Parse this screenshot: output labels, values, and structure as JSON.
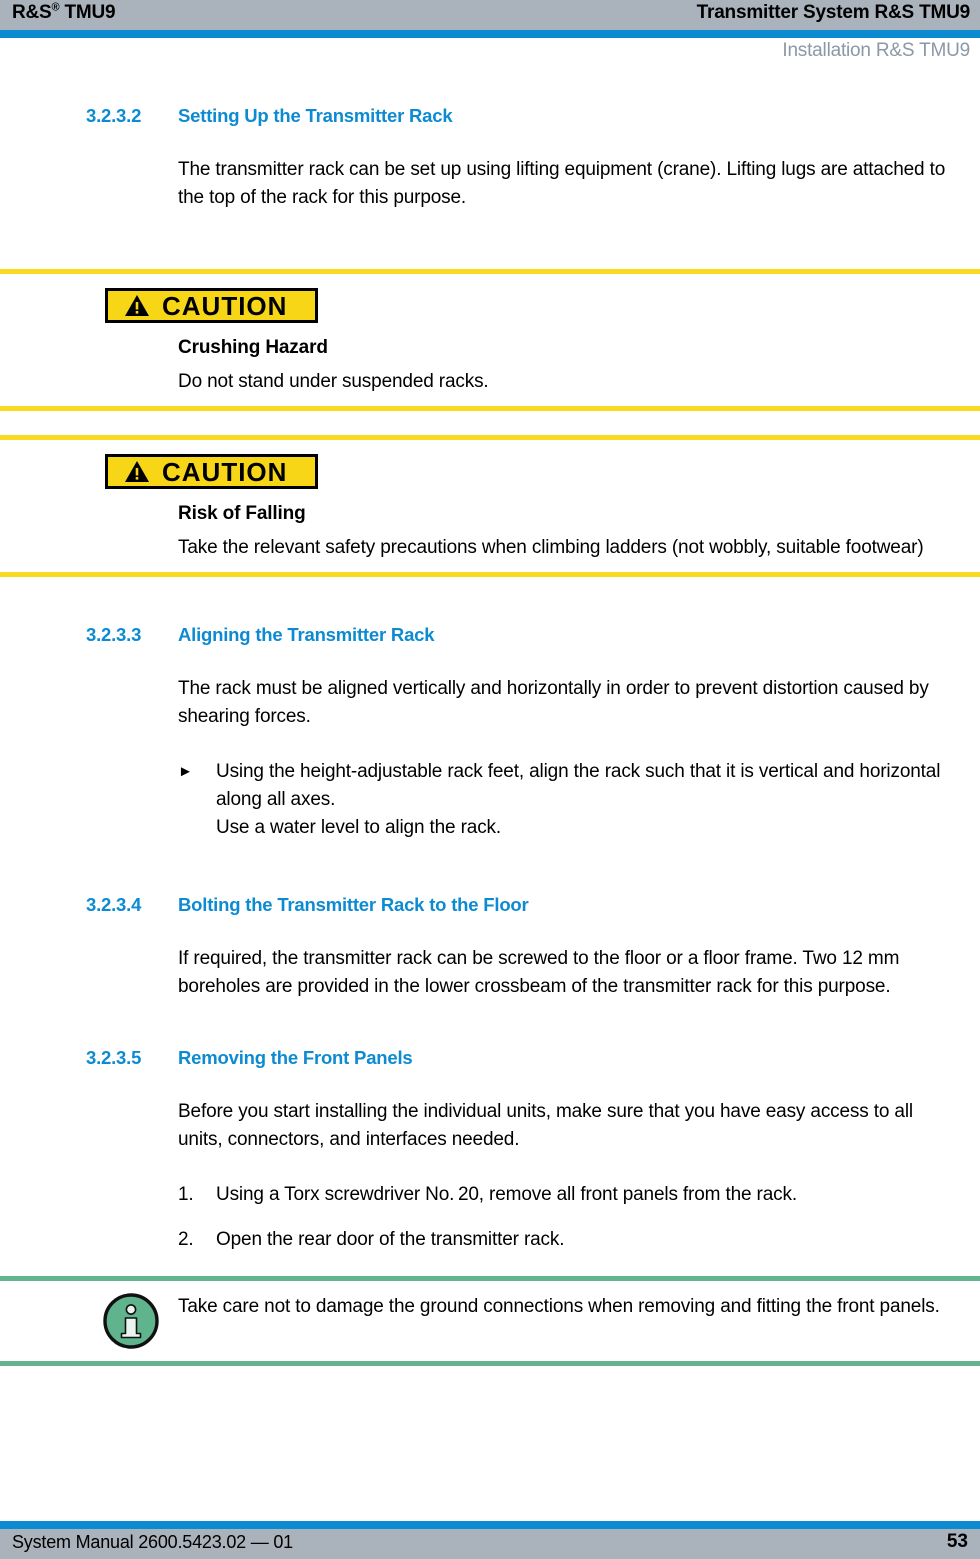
{
  "header": {
    "left_title": "R&S",
    "left_sup": "®",
    "left_model": " TMU9",
    "right_title": "Transmitter System R&S TMU9",
    "subheader": "Installation R&S TMU9"
  },
  "colors": {
    "header_gray": "#aab2bb",
    "accent_blue": "#0d8bd2",
    "heading_blue": "#0d8bd2",
    "subheader_gray": "#8b98a6",
    "caution_yellow": "#f6d617",
    "rule_yellow": "#fada21",
    "note_green": "#63b48e"
  },
  "sections": {
    "s3232": {
      "number": "3.2.3.2",
      "title": "Setting Up the Transmitter Rack",
      "paragraph": "The transmitter rack can be set up using lifting equipment (crane). Lifting lugs are attached to the top of the rack for this purpose."
    },
    "s3233": {
      "number": "3.2.3.3",
      "title": "Aligning the Transmitter Rack",
      "paragraph": "The rack must be aligned vertically and horizontally in order to prevent distortion caused by shearing forces.",
      "bullet_marker": "►",
      "bullet_text_line1": "Using the height-adjustable rack feet, align the rack such that it is vertical and horizontal along all axes.",
      "bullet_text_line2": "Use a water level to align the rack."
    },
    "s3234": {
      "number": "3.2.3.4",
      "title": "Bolting the Transmitter Rack to the Floor",
      "paragraph": "If required, the transmitter rack can be screwed to the floor or a floor frame. Two 12 mm boreholes are provided in the lower crossbeam of the transmitter rack for this purpose."
    },
    "s3235": {
      "number": "3.2.3.5",
      "title": "Removing the Front Panels",
      "paragraph": "Before you start installing the individual units, make sure that you have easy access to all units, connectors, and interfaces needed.",
      "steps": [
        {
          "marker": "1.",
          "text": "Using a Torx screwdriver No. 20, remove all front panels from the rack."
        },
        {
          "marker": "2.",
          "text": "Open the rear door of the transmitter rack."
        }
      ]
    }
  },
  "caution_1": {
    "label": "CAUTION",
    "title": "Crushing Hazard",
    "text": "Do not stand under suspended racks."
  },
  "caution_2": {
    "label": "CAUTION",
    "title": "Risk of Falling",
    "text": "Take the relevant safety precautions when climbing ladders (not wobbly, suitable footwear)"
  },
  "note": {
    "text": "Take care not to damage the ground connections when removing and fitting the front panels."
  },
  "footer": {
    "left": "System Manual 2600.5423.02 — 01",
    "page_number": "53"
  }
}
